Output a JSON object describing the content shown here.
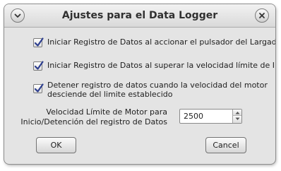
{
  "window": {
    "title": "Ajustes para el Data Logger"
  },
  "options": [
    {
      "label": "Iniciar Registro de Datos al accionar el pulsador del Largador",
      "checked": true
    },
    {
      "label": "Iniciar Registro de Datos al superar la velocidad límite de Inicio",
      "checked": true
    },
    {
      "label_line1": "Detener registro de datos cuando la velocidad del motor",
      "label_line2": "desciende del limite establecido",
      "checked": true
    }
  ],
  "speed_limit": {
    "label_line1": "Velocidad Límite de Motor para",
    "label_line2": "Inicio/Detención del registro de Datos",
    "value": "2500"
  },
  "buttons": {
    "ok": "OK",
    "cancel": "Cancel"
  },
  "icons": {
    "menu": "chevron-down-icon",
    "close": "close-icon",
    "check": "checkmark-icon",
    "spin_up": "triangle-up-icon",
    "spin_down": "triangle-down-icon"
  },
  "colors": {
    "window_bg": "#e4e4e4",
    "check_mark": "#2e3f8f"
  }
}
